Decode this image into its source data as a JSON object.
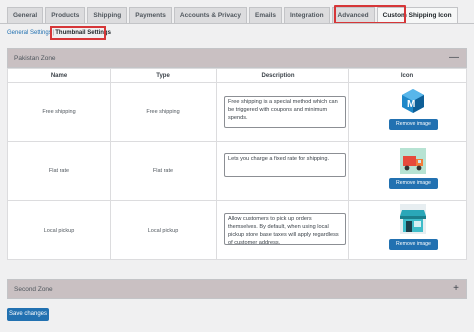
{
  "tabs": [
    {
      "label": "General"
    },
    {
      "label": "Products"
    },
    {
      "label": "Shipping"
    },
    {
      "label": "Payments"
    },
    {
      "label": "Accounts & Privacy"
    },
    {
      "label": "Emails"
    },
    {
      "label": "Integration"
    },
    {
      "label": "Advanced"
    },
    {
      "label": "Custom Shipping Icon",
      "active": true
    }
  ],
  "subnav": {
    "general_settings": "General Settings",
    "separator": "|",
    "thumbnail_settings": "Thumbnail Settings"
  },
  "zones": [
    {
      "name": "Pakistan Zone",
      "toggle": "—",
      "expanded": true
    },
    {
      "name": "Second Zone",
      "toggle": "+",
      "expanded": false
    }
  ],
  "table": {
    "columns": [
      "Name",
      "Type",
      "Description",
      "Icon"
    ],
    "rows": [
      {
        "name": "Free shipping",
        "type": "Free shipping",
        "description": "Free shipping is a special method which can be triggered with coupons and minimum spends.",
        "icon": "cube-logo-icon",
        "button": "Remove image"
      },
      {
        "name": "Flat rate",
        "type": "Flat rate",
        "description": "Lets you charge a fixed rate for shipping.",
        "icon": "delivery-truck-icon",
        "button": "Remove image"
      },
      {
        "name": "Local pickup",
        "type": "Local pickup",
        "description": "Allow customers to pick up orders themselves. By default, when using local pickup store base taxes will apply regardless of customer address.",
        "icon": "storefront-icon",
        "button": "Remove image"
      }
    ]
  },
  "save_button": "Save changes",
  "colors": {
    "accent": "#2271b1",
    "highlight": "#d63638",
    "zone_header": "#c9c0c2",
    "arrow": "#3b6fd4"
  }
}
